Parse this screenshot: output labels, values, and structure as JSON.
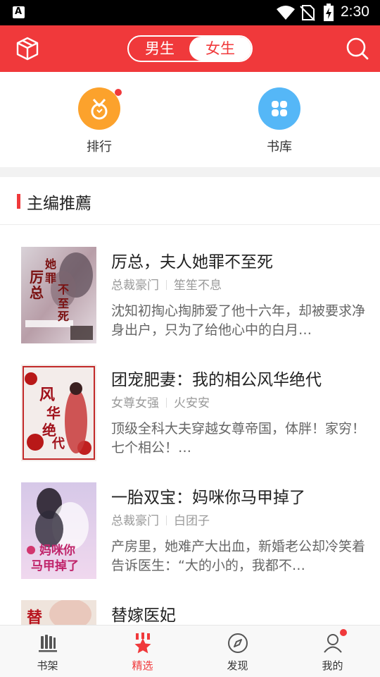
{
  "status_bar": {
    "time": "2:30",
    "app_icon_letter": "A"
  },
  "header": {
    "gender_options": [
      "男生",
      "女生"
    ],
    "selected_gender": "女生",
    "left_icon": "book-box-icon",
    "right_icon": "search-icon"
  },
  "quick_entries": [
    {
      "label": "排行",
      "icon": "medal-icon",
      "color": "#fca22c",
      "has_dot": true
    },
    {
      "label": "书库",
      "icon": "clover-icon",
      "color": "#55b7f7",
      "has_dot": false
    }
  ],
  "section": {
    "title": "主编推薦"
  },
  "books": [
    {
      "title": "厉总，夫人她罪不至死",
      "category": "总裁豪门",
      "author": "笙笙不息",
      "description": "沈知初掏心掏肺爱了他十六年，却被要求净身出户，只为了给他心中的白月…",
      "cover_text": "厉总夫人她罪不至死"
    },
    {
      "title": "团宠肥妻：我的相公风华绝代",
      "category": "女尊女强",
      "author": "火安安",
      "description": "顶级全科大夫穿越女尊帝国，体胖！家穷！七个相公！…",
      "cover_text": "风华绝代"
    },
    {
      "title": "一胎双宝：妈咪你马甲掉了",
      "category": "总裁豪门",
      "author": "白团子",
      "description": "产房里，她难产大出血，新婚老公却冷笑着告诉医生：“大的小的，我都不…",
      "cover_text": "妈咪你马甲掉了"
    },
    {
      "title": "替嫁医妃",
      "category": "",
      "author": "",
      "description": "",
      "cover_text": "替"
    }
  ],
  "bottom_nav": [
    {
      "label": "书架",
      "icon": "bookshelf-icon",
      "active": false
    },
    {
      "label": "精选",
      "icon": "featured-star-icon",
      "active": true
    },
    {
      "label": "发现",
      "icon": "compass-icon",
      "active": false
    },
    {
      "label": "我的",
      "icon": "user-icon",
      "active": false,
      "has_dot": true
    }
  ],
  "colors": {
    "accent": "#f0393b",
    "rank": "#fca22c",
    "library": "#55b7f7"
  }
}
